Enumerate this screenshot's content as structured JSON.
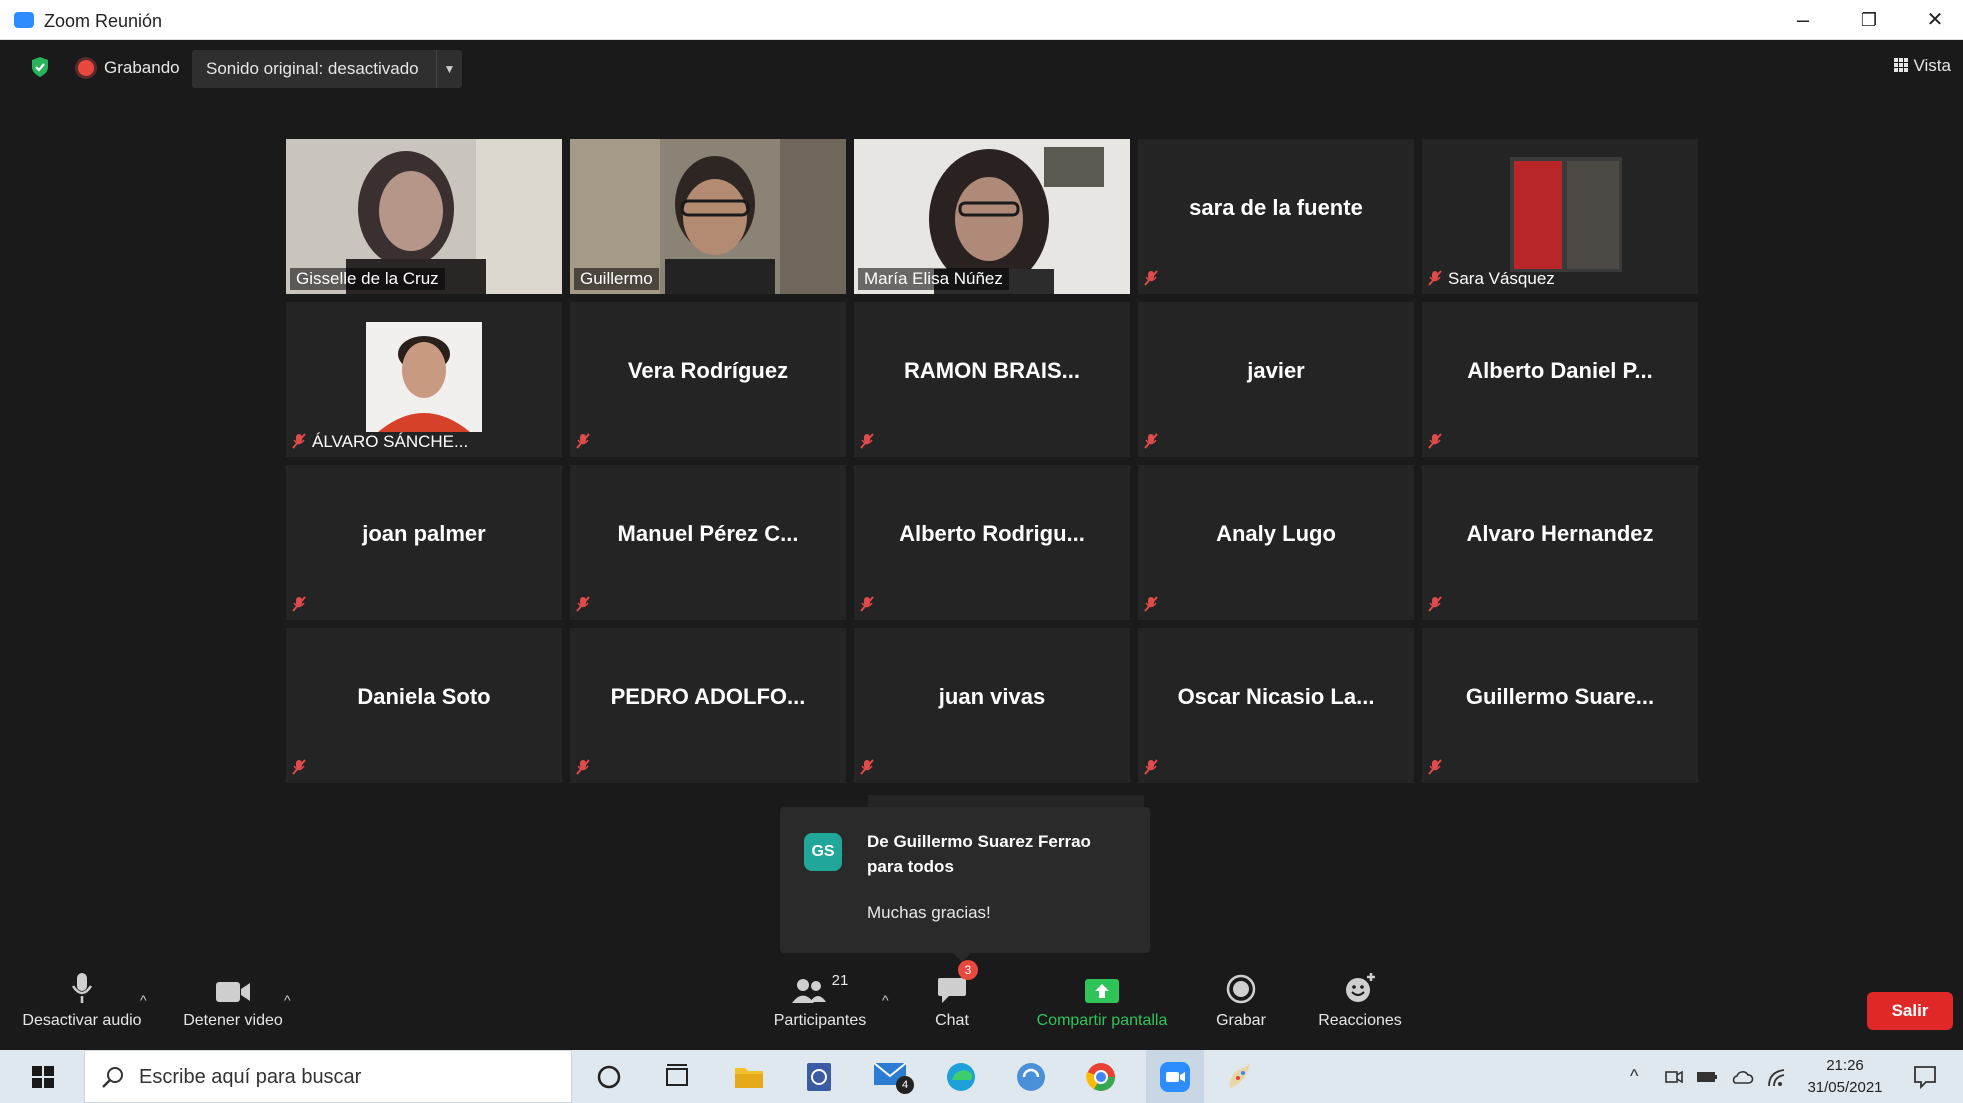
{
  "window": {
    "title": "Zoom Reunión",
    "min": "–",
    "restore": "❐",
    "close": "✕"
  },
  "topbar": {
    "recording_label": "Grabando",
    "original_sound": "Sonido original: desactivado",
    "view_label": "Vista"
  },
  "tiles": [
    {
      "name": "Gisselle de la Cruz",
      "video": true,
      "muted": false
    },
    {
      "name": "Guillermo",
      "video": true,
      "muted": false
    },
    {
      "name": "María Elisa Núñez",
      "video": true,
      "muted": false,
      "active_speaker": true
    },
    {
      "name": "sara de la fuente",
      "video": false,
      "muted": true
    },
    {
      "name": "Sara Vásquez",
      "video": true,
      "muted": true
    },
    {
      "name": "ÁLVARO SÁNCHE...",
      "video": true,
      "muted": true
    },
    {
      "name": "Vera Rodríguez",
      "video": false,
      "muted": true
    },
    {
      "name": "RAMON  BRAIS...",
      "video": false,
      "muted": true
    },
    {
      "name": "javier",
      "video": false,
      "muted": true
    },
    {
      "name": "Alberto  Daniel  P...",
      "video": false,
      "muted": true
    },
    {
      "name": "joan palmer",
      "video": false,
      "muted": true
    },
    {
      "name": "Manuel  Pérez  C...",
      "video": false,
      "muted": true
    },
    {
      "name": "Alberto  Rodrigu...",
      "video": false,
      "muted": true
    },
    {
      "name": "Analy Lugo",
      "video": false,
      "muted": true
    },
    {
      "name": "Alvaro Hernandez",
      "video": false,
      "muted": true
    },
    {
      "name": "Daniela Soto",
      "video": false,
      "muted": true
    },
    {
      "name": "PEDRO  ADOLFO...",
      "video": false,
      "muted": true
    },
    {
      "name": "juan vivas",
      "video": false,
      "muted": true
    },
    {
      "name": "Oscar  Nicasio  La...",
      "video": false,
      "muted": true
    },
    {
      "name": "Guillermo  Suare...",
      "video": false,
      "muted": true
    }
  ],
  "chat_popup": {
    "initials": "GS",
    "from": "De Guillermo Suarez Ferrao para todos",
    "message": "Muchas gracias!"
  },
  "controls": {
    "mute": "Desactivar audio",
    "video": "Detener video",
    "participants": "Participantes",
    "participants_count": "21",
    "chat": "Chat",
    "chat_badge": "3",
    "share": "Compartir pantalla",
    "record": "Grabar",
    "reactions": "Reacciones",
    "leave": "Salir"
  },
  "taskbar": {
    "search_placeholder": "Escribe aquí para buscar",
    "mail_badge": "4",
    "time": "21:26",
    "date": "31/05/2021"
  },
  "colors": {
    "active_border": "#d8e63a",
    "share_green": "#2ec45a",
    "leave_red": "#e02828",
    "avatar_teal": "#21a79a"
  }
}
